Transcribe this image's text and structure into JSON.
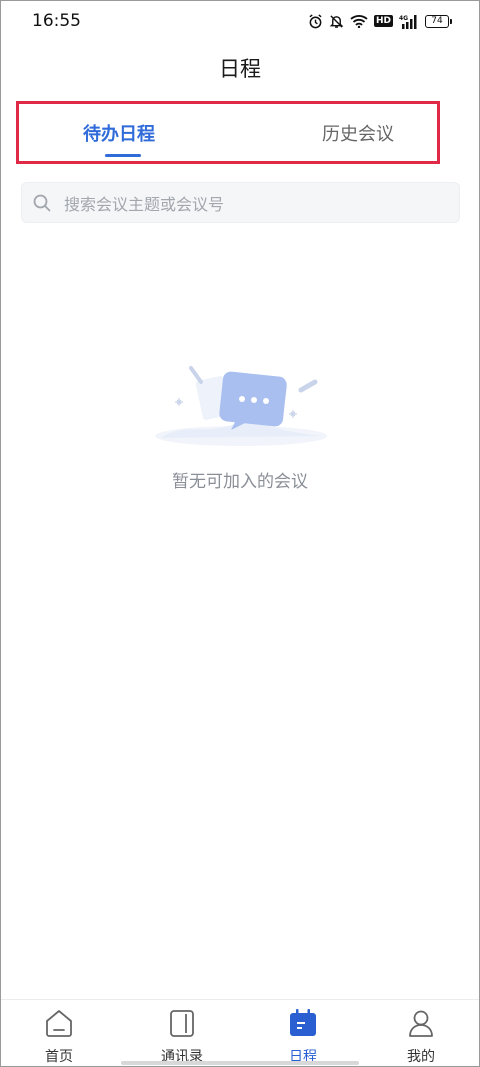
{
  "status_bar": {
    "time": "16:55",
    "icons": [
      "alarm-icon",
      "mute-bell-icon",
      "wifi-icon",
      "hd-badge",
      "signal-4g-icon",
      "battery-icon"
    ],
    "hd_label": "HD",
    "network_label": "4G",
    "battery_level": "74"
  },
  "header": {
    "title": "日程"
  },
  "tabs": {
    "items": [
      {
        "label": "待办日程",
        "active": true
      },
      {
        "label": "历史会议",
        "active": false
      }
    ],
    "highlight_color": "#e02a45",
    "active_color": "#2f6bd9"
  },
  "search": {
    "placeholder": "搜索会议主题或会议号",
    "icon": "search-icon"
  },
  "empty_state": {
    "illustration": "chat-bubble-illustration",
    "message": "暂无可加入的会议"
  },
  "bottom_nav": {
    "items": [
      {
        "label": "首页",
        "icon": "home-icon",
        "active": false
      },
      {
        "label": "通讯录",
        "icon": "contacts-book-icon",
        "active": false
      },
      {
        "label": "日程",
        "icon": "calendar-icon",
        "active": true
      },
      {
        "label": "我的",
        "icon": "person-icon",
        "active": false
      }
    ],
    "active_color": "#2a5fd1"
  }
}
